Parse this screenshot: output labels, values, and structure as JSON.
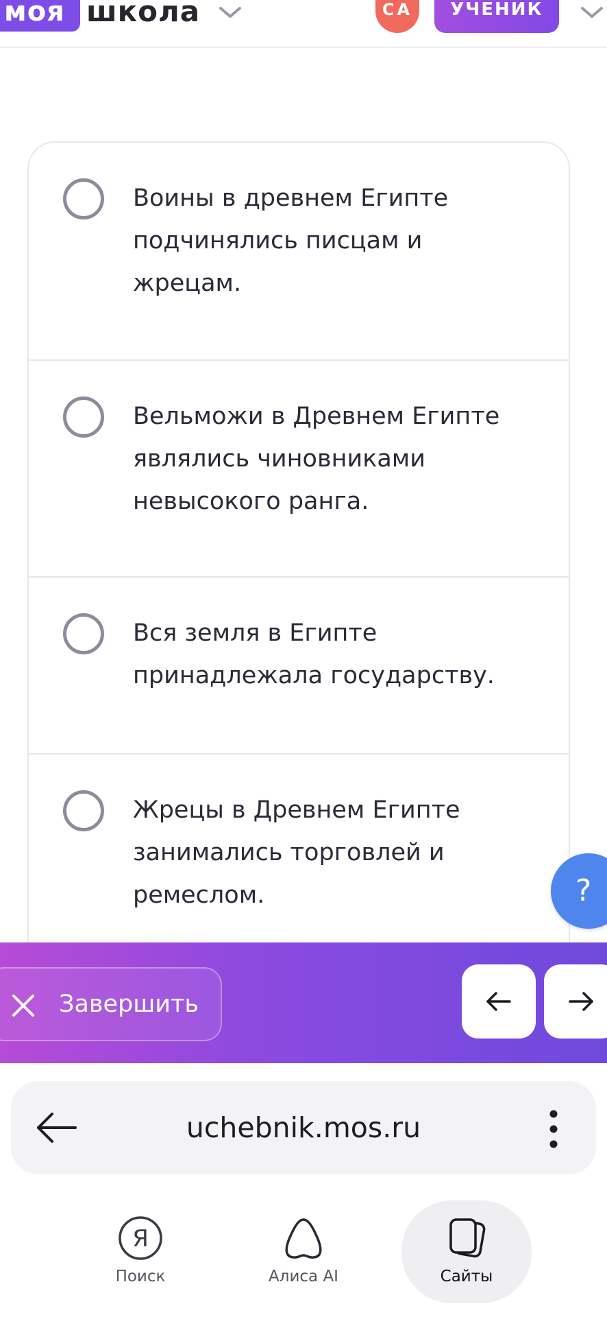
{
  "header": {
    "logo_part1": "моя",
    "logo_part2": "школа",
    "avatar_initials": "СА",
    "role": "УЧЕНИК"
  },
  "options": [
    {
      "text_lines": [
        "Воины в древнем Египте",
        "подчинялись писцам и",
        "жрецам."
      ],
      "selected": false
    },
    {
      "text_lines": [
        "Вельможи в Древнем Египте",
        "являлись чиновниками",
        "невысокого ранга."
      ],
      "selected": false
    },
    {
      "text_lines": [
        "Вся земля в Египте",
        "принадлежала государству."
      ],
      "selected": false
    },
    {
      "text_lines": [
        "Жрецы в Древнем Египте",
        "занимались торговлей и",
        "ремеслом."
      ],
      "selected": false
    }
  ],
  "help_label": "?",
  "action_bar": {
    "finish_label": "Завершить"
  },
  "browser": {
    "url": "uchebnik.mos.ru"
  },
  "bottom_nav": [
    {
      "label": "Поиск",
      "icon": "yandex-search-icon",
      "active": false
    },
    {
      "label": "Алиса AI",
      "icon": "alice-icon",
      "active": false
    },
    {
      "label": "Сайты",
      "icon": "sites-cards-icon",
      "active": true
    }
  ],
  "colors": {
    "brand_purple": "#7e4ce6",
    "avatar_red": "#f06a5e",
    "help_blue": "#4f86ee"
  }
}
